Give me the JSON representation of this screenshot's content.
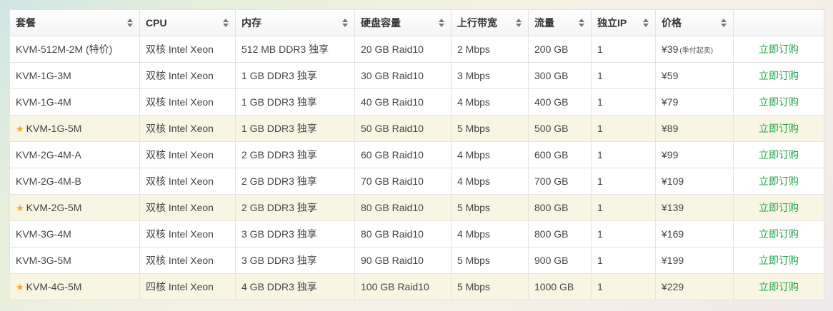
{
  "table": {
    "headers": [
      "套餐",
      "CPU",
      "内存",
      "硬盘容量",
      "上行带宽",
      "流量",
      "独立IP",
      "价格",
      ""
    ],
    "sortable": [
      true,
      true,
      true,
      true,
      true,
      true,
      true,
      true,
      false
    ],
    "rows": [
      {
        "plan": "KVM-512M-2M (特价)",
        "cpu": "双核 Intel Xeon",
        "mem": "512 MB DDR3 独享",
        "disk": "20 GB Raid10",
        "bw": "2 Mbps",
        "traffic": "200 GB",
        "ip": "1",
        "price": "¥39",
        "price_note": "(季付起卖)",
        "action": "立即订购",
        "recommended": false
      },
      {
        "plan": "KVM-1G-3M",
        "cpu": "双核 Intel Xeon",
        "mem": "1 GB DDR3 独享",
        "disk": "30 GB Raid10",
        "bw": "3 Mbps",
        "traffic": "300 GB",
        "ip": "1",
        "price": "¥59",
        "price_note": "",
        "action": "立即订购",
        "recommended": false
      },
      {
        "plan": "KVM-1G-4M",
        "cpu": "双核 Intel Xeon",
        "mem": "1 GB DDR3 独享",
        "disk": "40 GB Raid10",
        "bw": "4 Mbps",
        "traffic": "400 GB",
        "ip": "1",
        "price": "¥79",
        "price_note": "",
        "action": "立即订购",
        "recommended": false
      },
      {
        "plan": "KVM-1G-5M",
        "cpu": "双核 Intel Xeon",
        "mem": "1 GB DDR3 独享",
        "disk": "50 GB Raid10",
        "bw": "5 Mbps",
        "traffic": "500 GB",
        "ip": "1",
        "price": "¥89",
        "price_note": "",
        "action": "立即订购",
        "recommended": true
      },
      {
        "plan": "KVM-2G-4M-A",
        "cpu": "双核 Intel Xeon",
        "mem": "2 GB DDR3 独享",
        "disk": "60 GB Raid10",
        "bw": "4 Mbps",
        "traffic": "600 GB",
        "ip": "1",
        "price": "¥99",
        "price_note": "",
        "action": "立即订购",
        "recommended": false
      },
      {
        "plan": "KVM-2G-4M-B",
        "cpu": "双核 Intel Xeon",
        "mem": "2 GB DDR3 独享",
        "disk": "70 GB Raid10",
        "bw": "4 Mbps",
        "traffic": "700 GB",
        "ip": "1",
        "price": "¥109",
        "price_note": "",
        "action": "立即订购",
        "recommended": false
      },
      {
        "plan": "KVM-2G-5M",
        "cpu": "双核 Intel Xeon",
        "mem": "2 GB DDR3 独享",
        "disk": "80 GB Raid10",
        "bw": "5 Mbps",
        "traffic": "800 GB",
        "ip": "1",
        "price": "¥139",
        "price_note": "",
        "action": "立即订购",
        "recommended": true
      },
      {
        "plan": "KVM-3G-4M",
        "cpu": "双核 Intel Xeon",
        "mem": "3 GB DDR3 独享",
        "disk": "80 GB Raid10",
        "bw": "4 Mbps",
        "traffic": "800 GB",
        "ip": "1",
        "price": "¥169",
        "price_note": "",
        "action": "立即订购",
        "recommended": false
      },
      {
        "plan": "KVM-3G-5M",
        "cpu": "双核 Intel Xeon",
        "mem": "3 GB DDR3 独享",
        "disk": "90 GB Raid10",
        "bw": "5 Mbps",
        "traffic": "900 GB",
        "ip": "1",
        "price": "¥199",
        "price_note": "",
        "action": "立即订购",
        "recommended": false
      },
      {
        "plan": "KVM-4G-5M",
        "cpu": "四核 Intel Xeon",
        "mem": "4 GB DDR3 独享",
        "disk": "100 GB Raid10",
        "bw": "5 Mbps",
        "traffic": "1000 GB",
        "ip": "1",
        "price": "¥229",
        "price_note": "",
        "action": "立即订购",
        "recommended": true
      }
    ]
  },
  "icons": {
    "recommended": "star-icon",
    "sort": "sort-arrows-icon"
  },
  "colors": {
    "action_link": "#21a84a",
    "highlight_row": "#f8f6e2",
    "star": "#f5a623"
  }
}
